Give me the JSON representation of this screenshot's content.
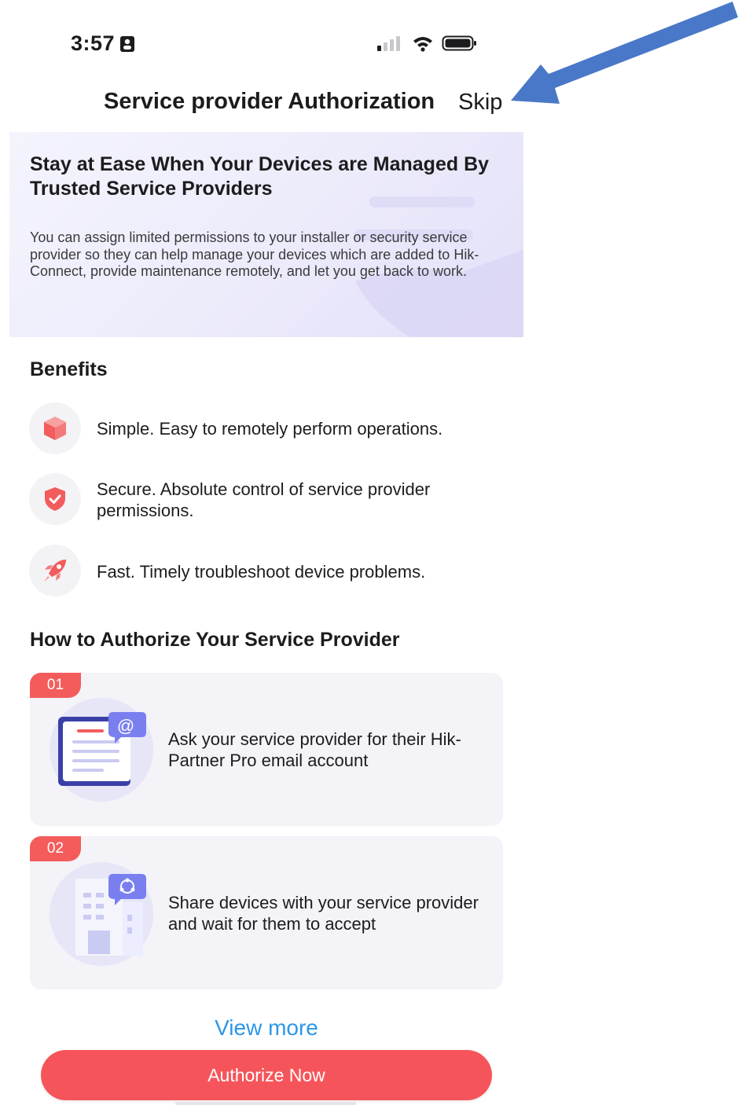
{
  "status_bar": {
    "time": "3:57"
  },
  "header": {
    "title": "Service provider Authorization",
    "skip_label": "Skip"
  },
  "hero": {
    "title": "Stay at Ease When Your Devices are Managed By Trusted Service Providers",
    "body": "You can assign limited permissions to your installer or security service provider so they can help manage your devices which are added to Hik-Connect, provide maintenance remotely, and let you get back to work."
  },
  "benefits": {
    "title": "Benefits",
    "items": [
      {
        "icon": "cube-icon",
        "text": "Simple. Easy to remotely perform operations."
      },
      {
        "icon": "shield-check-icon",
        "text": "Secure. Absolute control of service provider permissions."
      },
      {
        "icon": "rocket-icon",
        "text": "Fast. Timely troubleshoot device problems."
      }
    ]
  },
  "steps": {
    "title": "How to Authorize Your Service Provider",
    "items": [
      {
        "number": "01",
        "icon": "email-document-icon",
        "text": "Ask your service provider for their Hik-Partner Pro email account"
      },
      {
        "number": "02",
        "icon": "building-share-icon",
        "text": "Share devices with your service provider and wait for them to accept"
      }
    ]
  },
  "view_more_label": "View more",
  "authorize_label": "Authorize Now",
  "colors": {
    "accent_red": "#f5555a",
    "link_blue": "#2d96e8",
    "arrow_blue": "#4a78c8",
    "illustration_purple": "#7a7ff0"
  }
}
